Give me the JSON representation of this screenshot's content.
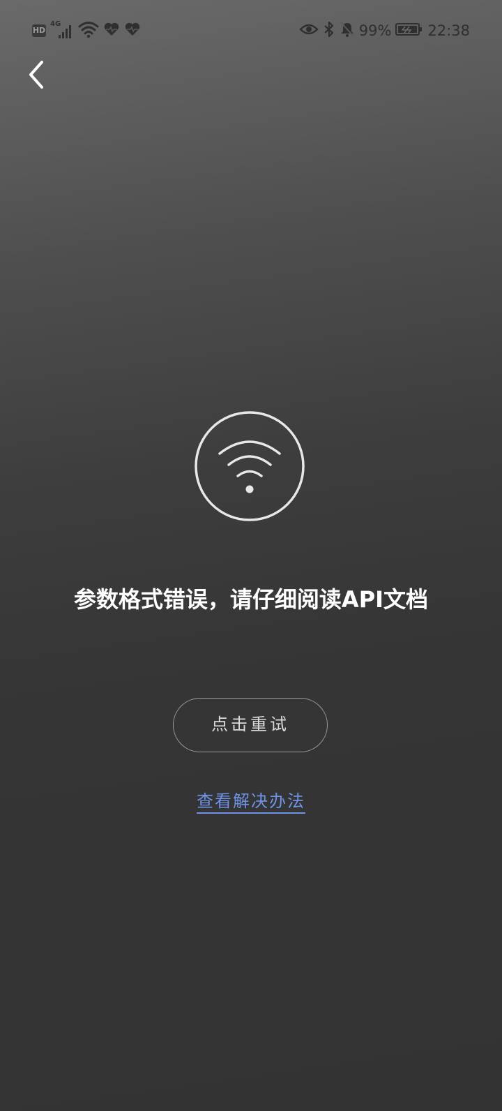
{
  "status_bar": {
    "hd_label": "HD",
    "network_label": "4G",
    "battery_percent": "99%",
    "time": "22:38",
    "icons": [
      "hd-icon",
      "signal-4g-icon",
      "wifi-icon",
      "heart-rate-icon",
      "heart-rate-icon",
      "eye-icon",
      "bluetooth-icon",
      "mute-icon",
      "battery-charging-icon"
    ]
  },
  "nav": {
    "back_icon": "chevron-left-icon"
  },
  "error_page": {
    "icon": "wifi-circle-icon",
    "message": "参数格式错误，请仔细阅读API文档",
    "retry_label": "点击重试",
    "solution_label": "查看解决办法"
  },
  "colors": {
    "link": "#6f93e6",
    "button_border": "#9a9a9a",
    "background_top": "#6a6a6a",
    "background_bottom": "#333333"
  }
}
